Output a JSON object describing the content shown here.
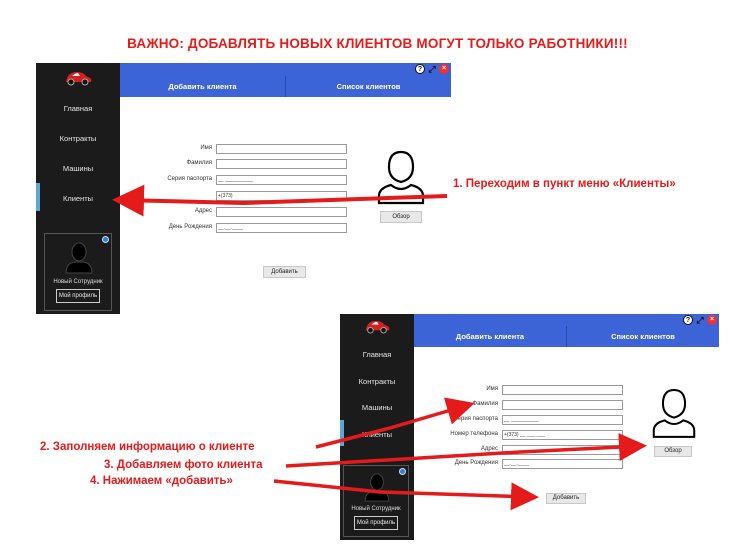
{
  "headline": "ВАЖНО: ДОБАВЛЯТЬ НОВЫХ КЛИЕНТОВ МОГУТ ТОЛЬКО РАБОТНИКИ!!!",
  "colors": {
    "accent": "#3d64d6",
    "sidebar": "#1b1b1b",
    "annotation": "#e51a1a",
    "active_bar": "#5aa7d8"
  },
  "app_screens": [
    {
      "sidebar": {
        "items": [
          {
            "label": "Главная"
          },
          {
            "label": "Контракты"
          },
          {
            "label": "Машины"
          },
          {
            "label": "Клиенты",
            "active": true
          }
        ],
        "profile": {
          "name": "Новый Сотрудник",
          "button": "Мой профиль"
        }
      },
      "window_icons": [
        "help-icon",
        "expand-icon",
        "close-icon"
      ],
      "tabs": [
        "Добавить клиента",
        "Список клиентов"
      ],
      "form": {
        "fields": [
          {
            "label": "Имя",
            "value": ""
          },
          {
            "label": "Фамилия",
            "value": ""
          },
          {
            "label": "Серия паспорта",
            "value": "__ __________"
          },
          {
            "label": "",
            "value": "+(373)"
          },
          {
            "label": "Адрес",
            "value": ""
          },
          {
            "label": "День Рождения",
            "value": "__.__.____"
          }
        ],
        "browse_button": "Обзор",
        "submit_button": "Добавить"
      }
    },
    {
      "sidebar": {
        "items": [
          {
            "label": "Главная"
          },
          {
            "label": "Контракты"
          },
          {
            "label": "Машины"
          },
          {
            "label": "Клиенты",
            "active": true
          }
        ],
        "profile": {
          "name": "Новый Сотрудник",
          "button": "Мой профиль"
        }
      },
      "window_icons": [
        "help-icon",
        "expand-icon",
        "close-icon"
      ],
      "tabs": [
        "Добавить клиента",
        "Список клиентов"
      ],
      "form": {
        "fields": [
          {
            "label": "Имя",
            "value": ""
          },
          {
            "label": "Фамилия",
            "value": ""
          },
          {
            "label": "Серия паспорта",
            "value": "__ __________"
          },
          {
            "label": "Номер телефона",
            "value": "+(373) __ ___ ___"
          },
          {
            "label": "Адрес",
            "value": ""
          },
          {
            "label": "День Рождения",
            "value": "__.__.____"
          }
        ],
        "browse_button": "Обзор",
        "submit_button": "Добавить"
      }
    }
  ],
  "annotations": {
    "step1": "1. Переходим в пункт меню «Клиенты»",
    "step2": "2. Заполняем информацию о клиенте",
    "step3": "3. Добавляем фото клиента",
    "step4": "4. Нажимаем «добавить»"
  }
}
